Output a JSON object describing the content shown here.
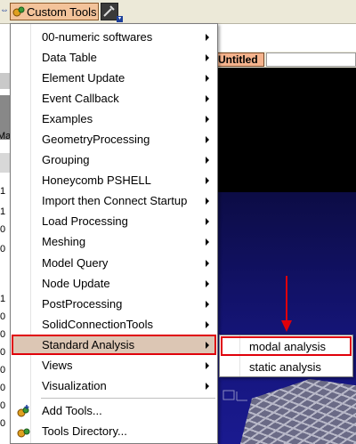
{
  "toolbar": {
    "custom_tools_label": "Custom Tools"
  },
  "tabs": {
    "untitled": "Untitled"
  },
  "left_strip": {
    "top_label": "Ma",
    "values": [
      ".1",
      ".1",
      ".0",
      ".0",
      ".1",
      ".0",
      ".0",
      ".0",
      ".0",
      ".0",
      ".0",
      ".0"
    ]
  },
  "menu": {
    "items": [
      {
        "label": "00-numeric softwares",
        "submenu": true
      },
      {
        "label": "Data Table",
        "submenu": true
      },
      {
        "label": "Element Update",
        "submenu": true
      },
      {
        "label": "Event Callback",
        "submenu": true
      },
      {
        "label": "Examples",
        "submenu": true
      },
      {
        "label": "GeometryProcessing",
        "submenu": true
      },
      {
        "label": "Grouping",
        "submenu": true
      },
      {
        "label": "Honeycomb PSHELL",
        "submenu": true
      },
      {
        "label": "Import then Connect Startup",
        "submenu": true
      },
      {
        "label": "Load Processing",
        "submenu": true
      },
      {
        "label": "Meshing",
        "submenu": true
      },
      {
        "label": "Model Query",
        "submenu": true
      },
      {
        "label": "Node Update",
        "submenu": true
      },
      {
        "label": "PostProcessing",
        "submenu": true
      },
      {
        "label": "SolidConnectionTools",
        "submenu": true
      },
      {
        "label": "Standard Analysis",
        "submenu": true
      },
      {
        "label": "Views",
        "submenu": true
      },
      {
        "label": "Visualization",
        "submenu": true
      }
    ],
    "footer_items": [
      {
        "label": "Add Tools..."
      },
      {
        "label": "Tools Directory..."
      }
    ]
  },
  "submenu": {
    "items": [
      {
        "label": "modal analysis"
      },
      {
        "label": "static analysis"
      }
    ]
  },
  "colors": {
    "highlight_outline": "#e0000a",
    "active_item_bg": "#dcc6b4",
    "button_bg": "#f3c39a"
  }
}
